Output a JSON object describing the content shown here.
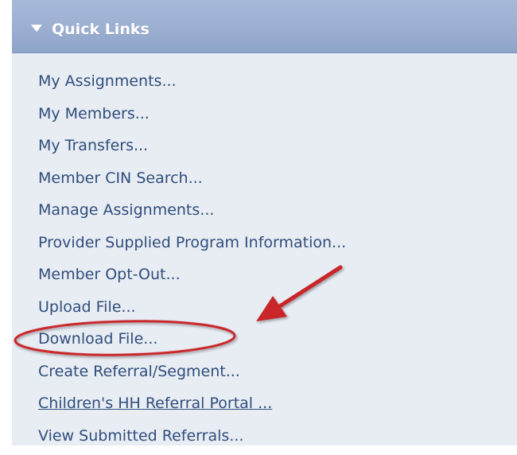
{
  "quick_links": {
    "title": "Quick Links",
    "items": [
      {
        "label": "My Assignments..."
      },
      {
        "label": "My Members..."
      },
      {
        "label": "My Transfers..."
      },
      {
        "label": "Member CIN Search..."
      },
      {
        "label": "Manage Assignments..."
      },
      {
        "label": "Provider Supplied Program Information..."
      },
      {
        "label": "Member Opt-Out..."
      },
      {
        "label": "Upload File..."
      },
      {
        "label": "Download File..."
      },
      {
        "label": "Create Referral/Segment..."
      },
      {
        "label": "Children's HH Referral Portal ..."
      },
      {
        "label": "View Submitted Referrals..."
      }
    ]
  },
  "annotation": {
    "highlight_color": "#c8262c",
    "arrow_color": "#c8262c",
    "highlighted_item": "Download File..."
  }
}
